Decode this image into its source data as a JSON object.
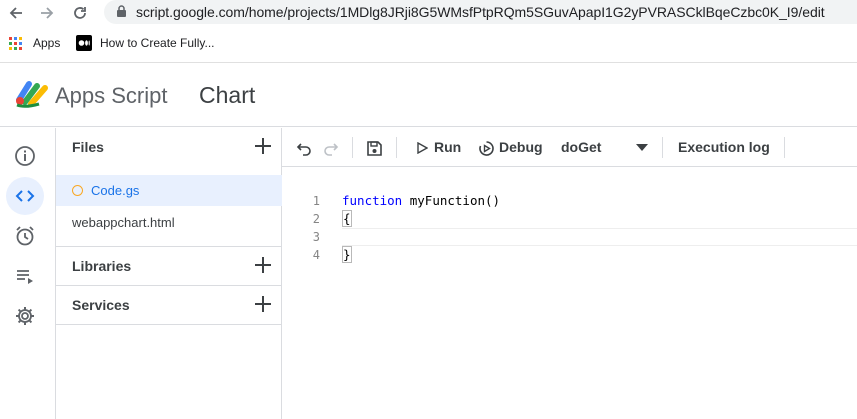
{
  "browser": {
    "url": "script.google.com/home/projects/1MDlg8JRji8G5WMsfPtpRQm5SGuvApapI1G2yPVRASCklBqeCzbc0K_I9/edit",
    "bookmarks": [
      {
        "label": "Apps",
        "icon": "apps-grid-icon"
      },
      {
        "label": "How to Create Fully...",
        "icon": "medium-logo-icon"
      }
    ]
  },
  "header": {
    "app_name": "Apps Script",
    "project_title": "Chart"
  },
  "rail": [
    "info-icon",
    "code-icon",
    "alarm-icon",
    "executions-icon",
    "settings-icon"
  ],
  "files_pane": {
    "files_label": "Files",
    "files": [
      {
        "name": "Code.gs",
        "active": true
      },
      {
        "name": "webappchart.html",
        "active": false
      }
    ],
    "libraries_label": "Libraries",
    "services_label": "Services"
  },
  "toolbar": {
    "run_label": "Run",
    "debug_label": "Debug",
    "function_select": "doGet",
    "execution_log_label": "Execution log"
  },
  "editor": {
    "line_numbers": [
      "1",
      "2",
      "3",
      "4"
    ],
    "lines": {
      "l1_keyword": "function",
      "l1_rest": " myFunction()",
      "l2": "{",
      "l3": "",
      "l4": "}"
    }
  },
  "colors": {
    "accent": "#1a73e8",
    "active_bg": "#e8f0fe",
    "divider": "#dadce0",
    "keyword": "#0000ff"
  }
}
